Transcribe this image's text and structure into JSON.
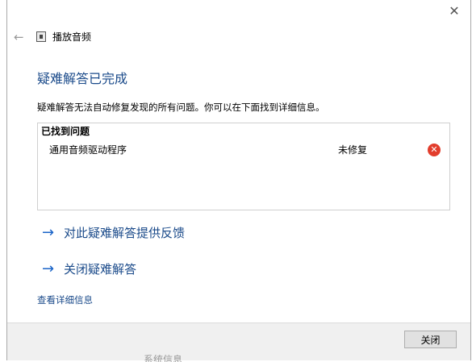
{
  "window": {
    "title": "播放音频",
    "close_glyph": "✕",
    "back_glyph": "←"
  },
  "main": {
    "heading": "疑难解答已完成",
    "description": "疑难解答无法自动修复发现的所有问题。你可以在下面找到详细信息。",
    "problems": {
      "header": "已找到问题",
      "items": [
        {
          "name": "通用音频驱动程序",
          "status": "未修复",
          "status_icon": "error-icon"
        }
      ]
    },
    "links": [
      {
        "arrow": "→",
        "label": "对此疑难解答提供反馈"
      },
      {
        "arrow": "→",
        "label": "关闭疑难解答"
      }
    ],
    "details_link": "查看详细信息"
  },
  "footer": {
    "close_button": "关闭"
  },
  "behind": {
    "text": "系统信息"
  },
  "colors": {
    "heading": "#1a4a8a",
    "link_arrow": "#1a64c8",
    "error": "#e23d2c",
    "footer_bg": "#f0f0f0"
  }
}
